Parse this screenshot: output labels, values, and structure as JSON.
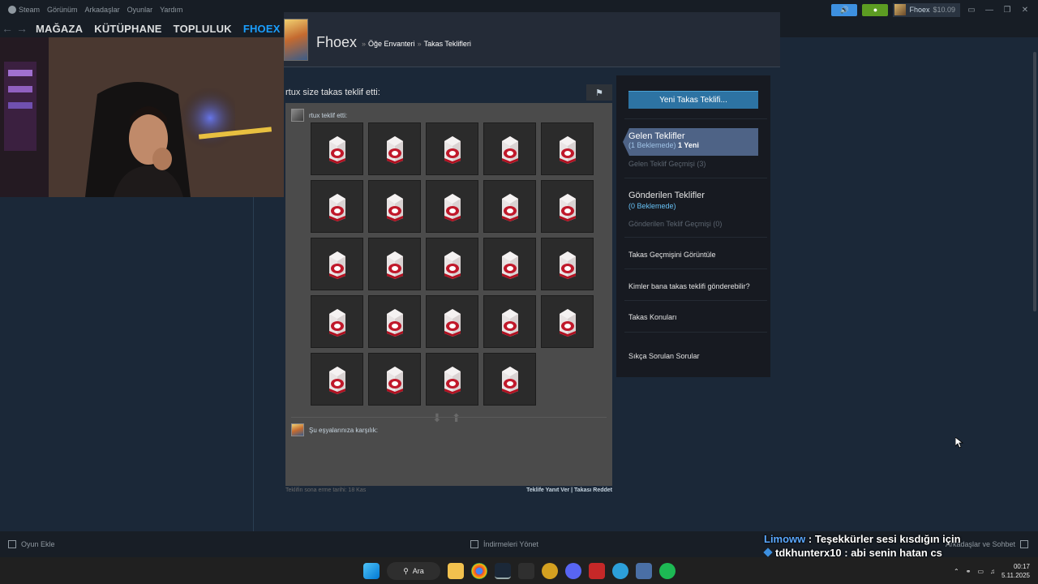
{
  "topbar": {
    "menu": [
      "Steam",
      "Görünüm",
      "Arkadaşlar",
      "Oyunlar",
      "Yardım"
    ],
    "account_name": "Fhoex",
    "balance": "$10.09"
  },
  "nav": {
    "links": [
      "MAĞAZA",
      "KÜTÜPHANE",
      "TOPLULUK",
      "FHOEX"
    ]
  },
  "profile": {
    "name": "Fhoex",
    "crumb1": "Öğe Envanteri",
    "crumb2": "Takas Teklifleri",
    "sep": "»"
  },
  "offer": {
    "title": "rtux size takas teklif etti:",
    "offerer_label": "rtux teklif etti:",
    "item_count": 24,
    "return_label": "Şu eşyalarınıza karşılık:",
    "footer_left": "Teklifin sona erme tarihi: 18 Kas",
    "footer_right": "Teklife Yanıt Ver | Takası Reddet"
  },
  "panel": {
    "new_offer": "Yeni Takas Teklifi...",
    "incoming_title": "Gelen Teklifler",
    "incoming_pending": "(1 Beklemede)",
    "incoming_new": "1 Yeni",
    "incoming_history": "Gelen Teklif Geçmişi (3)",
    "sent_title": "Gönderilen Teklifler",
    "sent_pending": "(0 Beklemede)",
    "sent_history": "Gönderilen Teklif Geçmişi (0)",
    "view_history": "Takas Geçmişini Görüntüle",
    "who_can": "Kimler bana takas teklifi gönderebilir?",
    "topics": "Takas Konuları",
    "faq": "Sıkça Sorulan Sorular"
  },
  "bottombar": {
    "add_game": "Oyun Ekle",
    "downloads": "İndirmeleri Yönet",
    "friends": "Arkadaşlar ve Sohbet"
  },
  "chat": {
    "user1": "Limoww",
    "msg1": ": Teşekkürler sesi kısdığın için",
    "user2": "tdkhunterx10",
    "msg2": ": abi senin hatan cs valorant giriyorsun"
  },
  "taskbar": {
    "search": "Ara",
    "time": "00:17",
    "date": "5.11.2025"
  },
  "colors": {
    "steam_bg": "#1b2838",
    "accent": "#1a9fff",
    "new_offer_button": "#2d73a3",
    "incoming_selected": "#4e6386"
  }
}
